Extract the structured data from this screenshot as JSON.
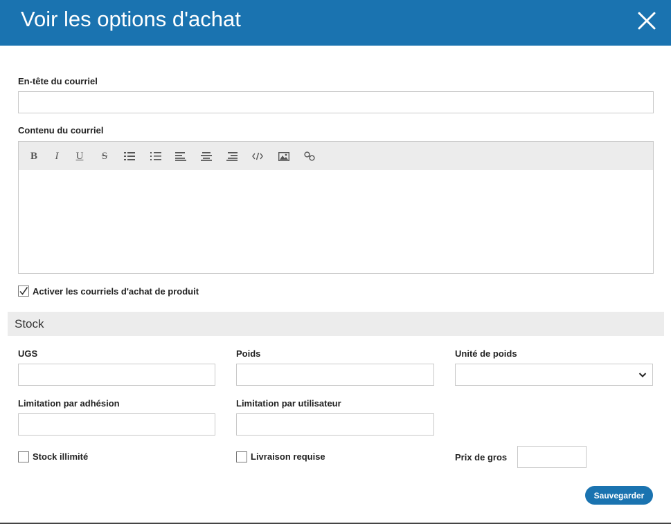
{
  "dialog": {
    "title": "Voir les options d'achat",
    "close_icon": "close-icon"
  },
  "email": {
    "header_label": "En-tête du courriel",
    "header_value": "",
    "content_label": "Contenu du courriel",
    "content_value": "",
    "toolbar": [
      {
        "name": "bold-button",
        "icon": "bold-icon",
        "glyph": "B"
      },
      {
        "name": "italic-button",
        "icon": "italic-icon",
        "glyph": "I"
      },
      {
        "name": "underline-button",
        "icon": "underline-icon",
        "glyph": "U"
      },
      {
        "name": "strikethrough-button",
        "icon": "strikethrough-icon",
        "glyph": "S"
      },
      {
        "name": "bullet-list-button",
        "icon": "bullet-list-icon"
      },
      {
        "name": "numbered-list-button",
        "icon": "numbered-list-icon"
      },
      {
        "name": "align-left-button",
        "icon": "align-left-icon"
      },
      {
        "name": "align-center-button",
        "icon": "align-center-icon"
      },
      {
        "name": "align-right-button",
        "icon": "align-right-icon"
      },
      {
        "name": "code-button",
        "icon": "code-icon"
      },
      {
        "name": "image-button",
        "icon": "image-icon"
      },
      {
        "name": "link-button",
        "icon": "link-icon"
      }
    ],
    "enable_label": "Activer les courriels d'achat de produit",
    "enable_checked": true
  },
  "stock": {
    "section_title": "Stock",
    "sku_label": "UGS",
    "sku_value": "",
    "weight_label": "Poids",
    "weight_value": "",
    "weight_unit_label": "Unité de poids",
    "weight_unit_value": "",
    "membership_limit_label": "Limitation par adhésion",
    "membership_limit_value": "",
    "user_limit_label": "Limitation par utilisateur",
    "user_limit_value": "",
    "unlimited_stock_label": "Stock illimité",
    "unlimited_stock_checked": false,
    "shipping_required_label": "Livraison requise",
    "shipping_required_checked": false,
    "wholesale_price_label": "Prix de gros",
    "wholesale_price_value": ""
  },
  "actions": {
    "save_label": "Sauvegarder"
  },
  "colors": {
    "accent": "#1a73b0",
    "toolbar_bg": "#ececec",
    "border": "#c8c8c8"
  }
}
